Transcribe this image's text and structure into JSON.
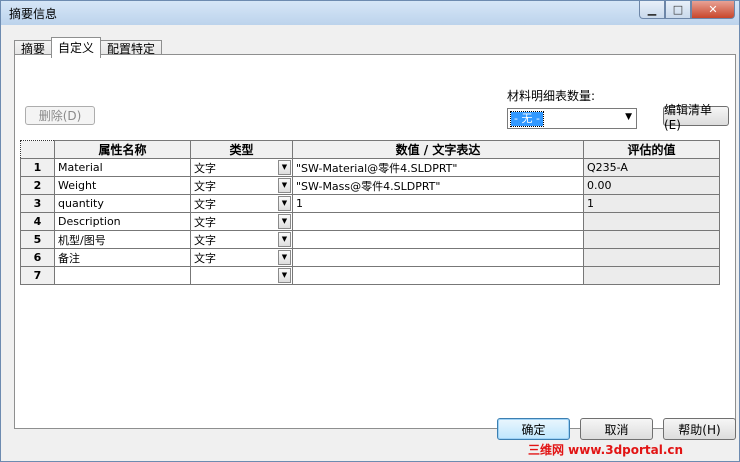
{
  "window": {
    "title": "摘要信息",
    "min_glyph": "▁",
    "max_glyph": "□",
    "close_glyph": "✕"
  },
  "tabs": [
    {
      "label": "摘要"
    },
    {
      "label": "自定义",
      "active": true
    },
    {
      "label": "配置特定"
    }
  ],
  "toolbar": {
    "delete_label": "删除(D)",
    "qty_label": "材料明细表数量:",
    "qty_value": "- 无 -",
    "edit_list_label": "编辑清单(E)"
  },
  "table": {
    "headers": [
      "属性名称",
      "类型",
      "数值 / 文字表达",
      "评估的值"
    ],
    "rows": [
      {
        "num": "1",
        "name": "Material",
        "type": "文字",
        "value": "\"SW-Material@零件4.SLDPRT\"",
        "eval": "Q235-A"
      },
      {
        "num": "2",
        "name": "Weight",
        "type": "文字",
        "value": "\"SW-Mass@零件4.SLDPRT\"",
        "eval": "0.00"
      },
      {
        "num": "3",
        "name": "quantity",
        "type": "文字",
        "value": "1",
        "eval": "1"
      },
      {
        "num": "4",
        "name": "Description",
        "type": "文字",
        "value": "",
        "eval": ""
      },
      {
        "num": "5",
        "name": "机型/图号",
        "type": "文字",
        "value": "",
        "eval": ""
      },
      {
        "num": "6",
        "name": "备注",
        "type": "文字",
        "value": "",
        "eval": ""
      },
      {
        "num": "7",
        "name": "",
        "type": "",
        "value": "",
        "eval": ""
      }
    ]
  },
  "footer": {
    "ok_label": "确定",
    "cancel_label": "取消",
    "help_label": "帮助(H)"
  },
  "watermark": "三维网 www.3dportal.cn",
  "colors": {
    "selection": "#3399ff",
    "watermark": "#e21414"
  }
}
